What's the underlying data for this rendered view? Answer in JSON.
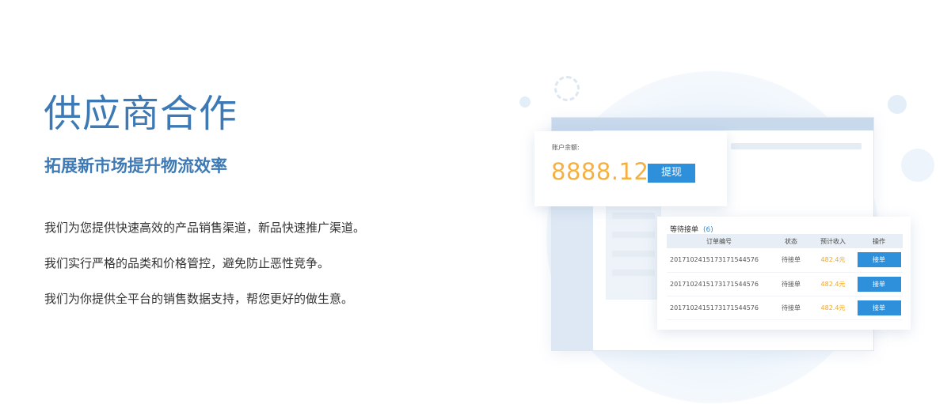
{
  "hero": {
    "title": "供应商合作",
    "subtitle": "拓展新市场提升物流效率",
    "features": [
      "我们为您提供快速高效的产品销售渠道，新品快速推广渠道。",
      "我们实行严格的品类和价格管控，避免防止恶性竞争。",
      "我们为你提供全平台的销售数据支持，帮您更好的做生意。"
    ]
  },
  "balance_card": {
    "label": "账户余额:",
    "value": "8888.12",
    "withdraw_label": "提现"
  },
  "orders_card": {
    "title": "等待接单",
    "count": "(6)",
    "columns": [
      "订单编号",
      "状态",
      "预计收入",
      "操作"
    ],
    "rows": [
      {
        "id": "2017102415173171544576",
        "status": "待接单",
        "income": "482.4元",
        "action": "接单"
      },
      {
        "id": "2017102415173171544576",
        "status": "待接单",
        "income": "482.4元",
        "action": "接单"
      },
      {
        "id": "2017102415173171544576",
        "status": "待接单",
        "income": "482.4元",
        "action": "接单"
      }
    ]
  },
  "colors": {
    "brand_blue": "#3d7ab5",
    "button_blue": "#2e8fdb",
    "amount_orange": "#f5b041"
  }
}
